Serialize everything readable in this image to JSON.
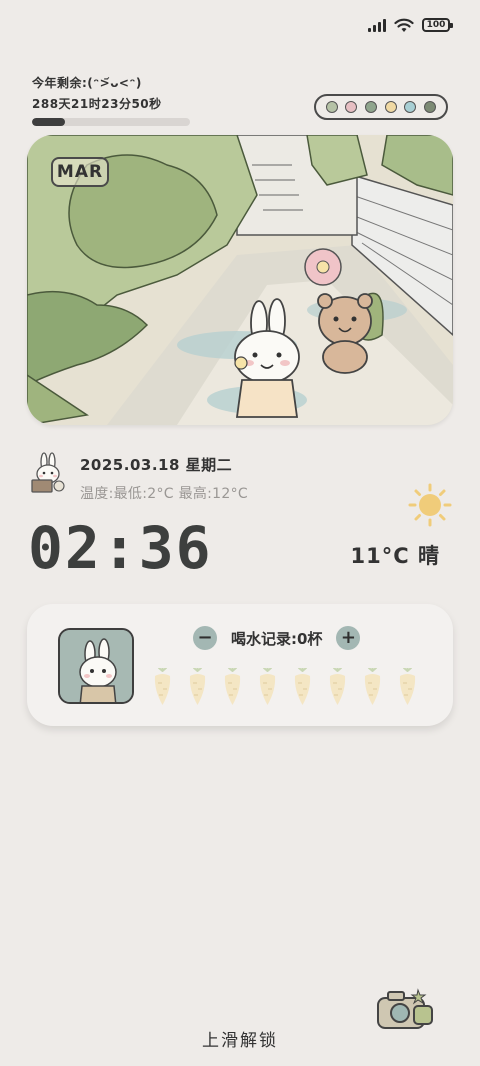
{
  "status_bar": {
    "battery": "100",
    "icons": [
      "signal-icon",
      "wifi-icon",
      "battery-icon"
    ]
  },
  "year_remaining": {
    "title": "今年剩余:(ᵔ>᷄ᴗ<ᵔ)",
    "countdown": "288天21时23分50秒",
    "progress_percent": 21
  },
  "palette": {
    "colors": [
      "#b5c2a6",
      "#e7bfc3",
      "#8fa58d",
      "#f0d9a3",
      "#a8cfd4",
      "#7c8a74"
    ]
  },
  "photo": {
    "month_badge": "MAR"
  },
  "date": {
    "date_text": "2025.03.18 星期二",
    "temperature_text": "温度:最低:2°C  最高:12°C"
  },
  "clock": {
    "time": "02:36"
  },
  "weather": {
    "now": "11°C 晴",
    "icon": "sun-icon"
  },
  "water": {
    "label": "喝水记录:0杯",
    "minus": "−",
    "plus": "+",
    "cups_drunk": 0,
    "cups_total": 8
  },
  "unlock": {
    "label": "上滑解锁"
  },
  "colors": {
    "background": "#eeebe8",
    "accent": "#a3b7b3",
    "text": "#333333"
  }
}
